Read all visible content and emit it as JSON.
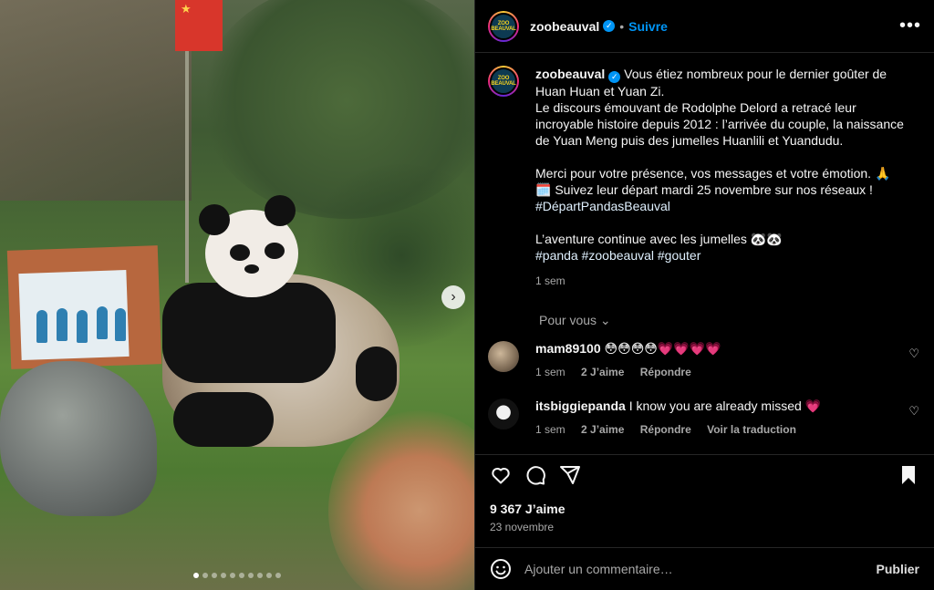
{
  "post": {
    "username": "zoobeauval",
    "follow_label": "Suivre",
    "more_label": "•••",
    "avatar_text_line1": "ZOO",
    "avatar_text_line2": "BEAUVAL"
  },
  "media": {
    "next_label": "›",
    "slide_count": 10,
    "current_slide": 1
  },
  "caption": {
    "username": "zoobeauval",
    "line1": "Vous étiez nombreux pour le dernier goûter de Huan Huan et Yuan Zi.",
    "line2": "Le discours émouvant de Rodolphe Delord a retracé leur incroyable histoire depuis 2012 : l’arrivée du couple, la naissance de Yuan Meng puis des jumelles Huanlili et Yuandudu.",
    "line3": "Merci pour votre présence, vos messages et votre émotion. 🙏",
    "line4": "🗓️ Suivez leur départ mardi 25 novembre sur nos réseaux !",
    "hashtag1": "#DépartPandasBeauval",
    "line5": "L’aventure continue avec les jumelles 🐼🐼",
    "hashtags2": "#panda #zoobeauval #gouter",
    "time": "1 sem"
  },
  "see_more_label": "Pour vous ⌄",
  "comments": [
    {
      "username": "mam89100",
      "text": "😳😳😳😳💗💗💗💗",
      "time": "1 sem",
      "likes": "2 J’aime",
      "reply": "Répondre"
    },
    {
      "username": "itsbiggiepanda",
      "text": "I know you are already missed 💗",
      "time": "1 sem",
      "likes": "2 J’aime",
      "reply": "Répondre",
      "translate": "Voir la traduction"
    }
  ],
  "stats": {
    "likes": "9 367 J’aime",
    "date": "23 novembre"
  },
  "comment_box": {
    "placeholder": "Ajouter un commentaire…",
    "publish": "Publier"
  },
  "colors": {
    "accent": "#0095f6",
    "background": "#000000",
    "muted_text": "#a8a8a8",
    "heart": "#ff3b5c"
  }
}
